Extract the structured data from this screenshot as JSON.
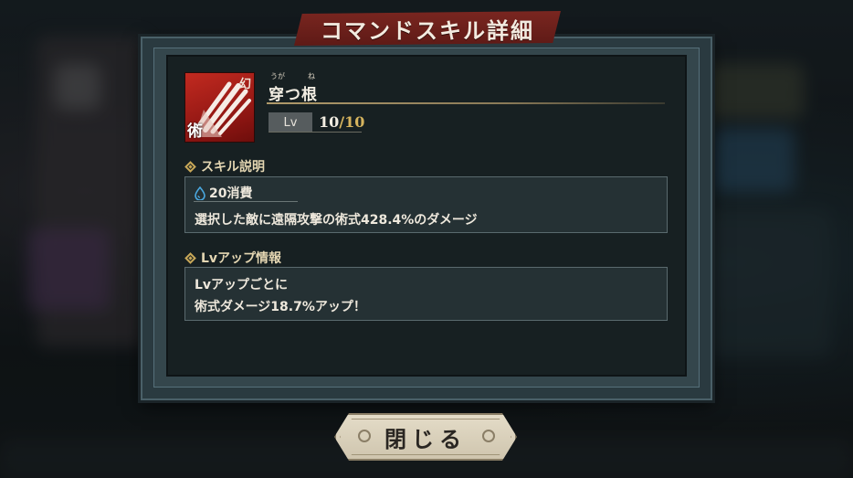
{
  "dialog": {
    "title": "コマンドスキル詳細",
    "close_label": "閉じる"
  },
  "skill": {
    "icon_name": "claw-strike-icon",
    "icon_corner_top": "幻",
    "icon_corner_bottom": "術",
    "name": "穿つ根",
    "furigana_1": "うが",
    "furigana_2": "ね",
    "level_label": "Lv",
    "level_current": "10",
    "level_max": "/10"
  },
  "description": {
    "heading": "スキル説明",
    "cost": "20消費",
    "text": "選択した敵に遠隔攻撃の術式428.4%のダメージ"
  },
  "level_up": {
    "heading": "Lvアップ情報",
    "line1": "Lvアップごとに",
    "line2": "術式ダメージ18.7%アップ！"
  },
  "colors": {
    "title_banner": "#7a2620",
    "icon_bg": "#c22a20",
    "accent_gold": "#d6b45e",
    "cost_icon": "#4aa8e0"
  }
}
